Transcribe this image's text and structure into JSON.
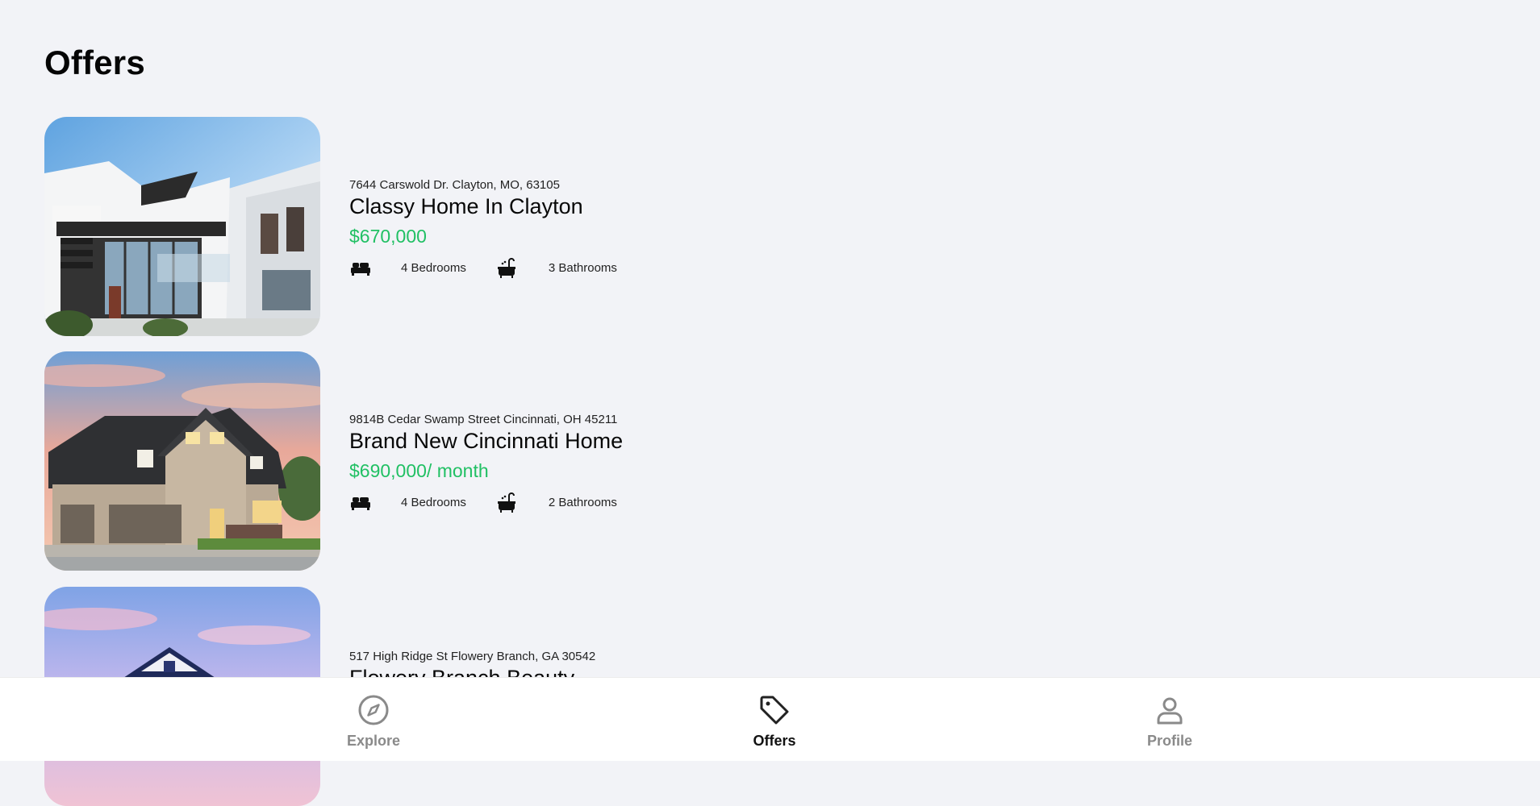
{
  "page": {
    "title": "Offers"
  },
  "listings": [
    {
      "address": "7644 Carswold Dr. Clayton, MO, 63105",
      "name": "Classy Home In Clayton",
      "price": "$670,000",
      "bedrooms": "4 Bedrooms",
      "bathrooms": "3 Bathrooms",
      "photo_icon": "modern-house-photo"
    },
    {
      "address": "9814B Cedar Swamp Street Cincinnati, OH 45211",
      "name": "Brand New Cincinnati Home",
      "price": "$690,000/ month",
      "bedrooms": "4 Bedrooms",
      "bathrooms": "2 Bathrooms",
      "photo_icon": "suburban-house-photo"
    },
    {
      "address": "517 High Ridge St Flowery Branch, GA 30542",
      "name": "Flowery Branch Beauty",
      "photo_icon": "blue-house-photo"
    }
  ],
  "icons": {
    "bedroom": "bed-icon",
    "bathroom": "bathtub-icon"
  },
  "nav": {
    "items": [
      {
        "label": "Explore",
        "icon": "compass-icon",
        "active": false
      },
      {
        "label": "Offers",
        "icon": "tag-icon",
        "active": true
      },
      {
        "label": "Profile",
        "icon": "user-icon",
        "active": false
      }
    ]
  },
  "colors": {
    "price": "#21c064",
    "background": "#f2f3f7",
    "nav_inactive": "#8a8a8a",
    "nav_active": "#111111"
  }
}
